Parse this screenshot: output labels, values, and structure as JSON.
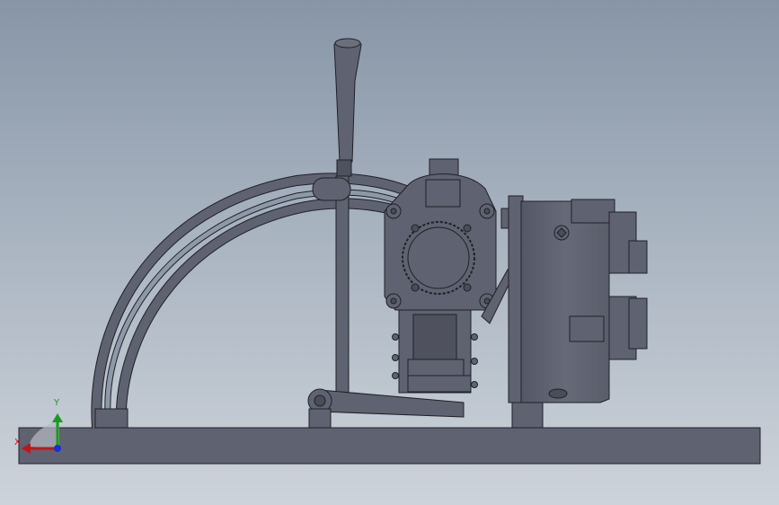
{
  "viewport": {
    "background_top": "#8795a6",
    "background_bottom": "#cdd3da",
    "part_fill": "#5f6270",
    "part_dark": "#4a4d58",
    "edge_color": "#1f2128"
  },
  "triad": {
    "x_label": "X",
    "y_label": "Y",
    "x_color": "#c0161c",
    "y_color": "#1a9a1a",
    "z_color": "#1c2ed1"
  }
}
